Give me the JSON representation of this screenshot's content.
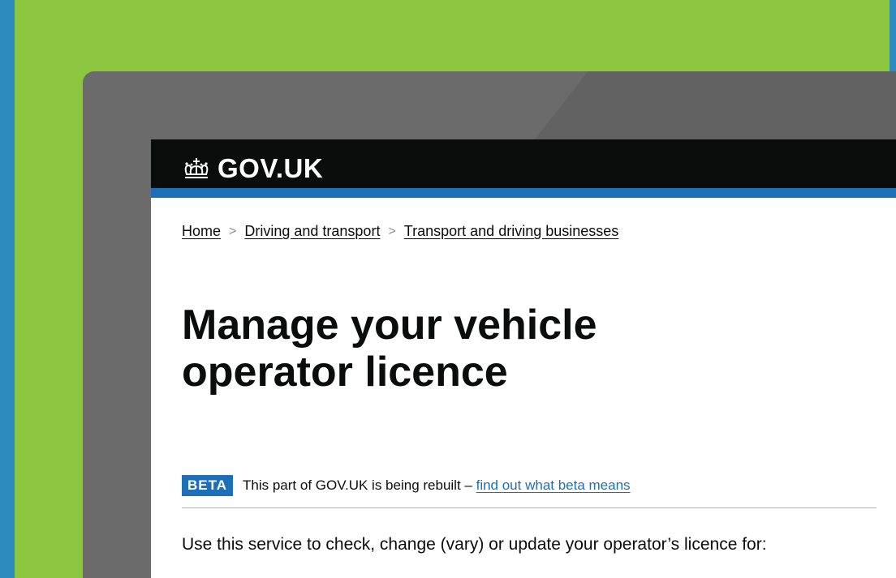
{
  "header": {
    "brand": "GOV.UK",
    "logo_icon": "crown-icon"
  },
  "breadcrumb": {
    "items": [
      "Home",
      "Driving and transport",
      "Transport and driving businesses"
    ],
    "separator": ">"
  },
  "page": {
    "title_line1": "Manage your vehicle",
    "title_line2": "operator licence"
  },
  "beta_banner": {
    "tag": "BETA",
    "text": "This part of GOV.UK is being rebuilt –",
    "link": "find out what beta means"
  },
  "body": {
    "lead": "Use this service to check, change (vary) or update your operator’s licence for:"
  },
  "colors": {
    "background_blue": "#2e8bbe",
    "panel_green": "#8cc63e",
    "device_grey": "#6b6b6b",
    "header_black": "#0b0c0c",
    "accent_blue": "#1d70b8"
  }
}
